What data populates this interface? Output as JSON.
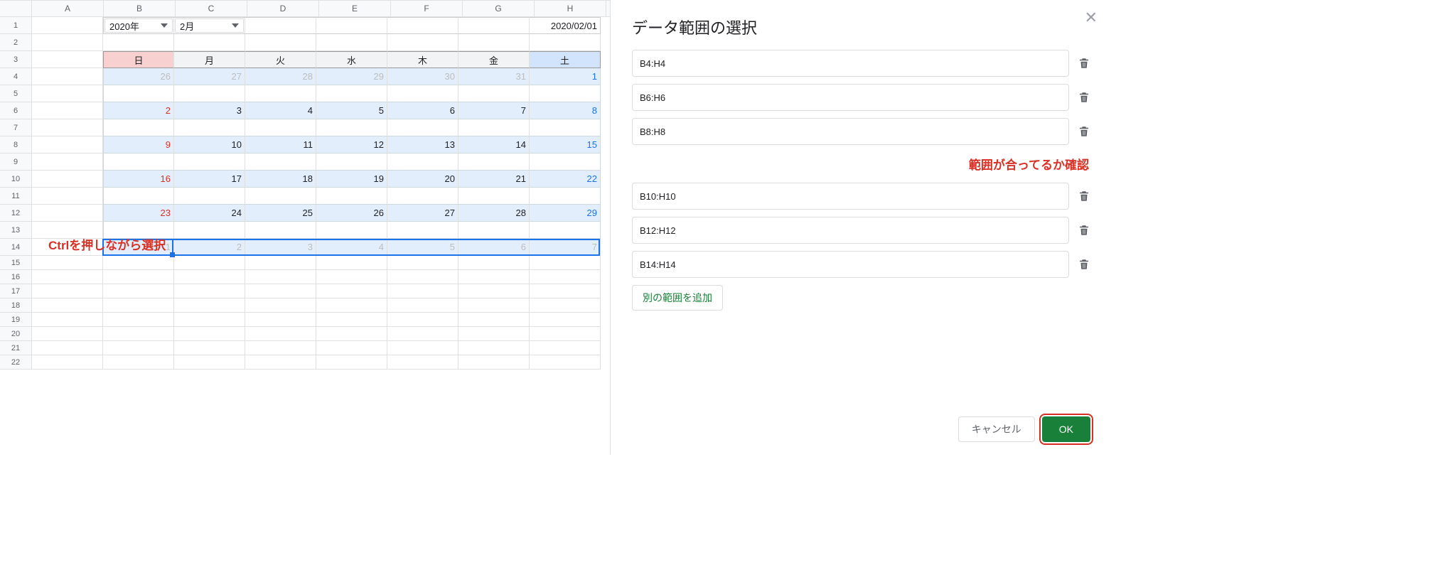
{
  "columns": [
    "A",
    "B",
    "C",
    "D",
    "E",
    "F",
    "G",
    "H"
  ],
  "row_count": 22,
  "dropdowns": {
    "year": "2020年",
    "month": "2月"
  },
  "date_cell": "2020/02/01",
  "day_headers": [
    "日",
    "月",
    "火",
    "水",
    "木",
    "金",
    "土"
  ],
  "calendar": [
    {
      "row": 4,
      "nums": [
        "26",
        "27",
        "28",
        "29",
        "30",
        "31",
        "1"
      ],
      "gray": [
        0,
        1,
        2,
        3,
        4,
        5
      ],
      "sun": null,
      "sat": 6
    },
    {
      "row": 6,
      "nums": [
        "2",
        "3",
        "4",
        "5",
        "6",
        "7",
        "8"
      ],
      "gray": [],
      "sun": 0,
      "sat": 6
    },
    {
      "row": 8,
      "nums": [
        "9",
        "10",
        "11",
        "12",
        "13",
        "14",
        "15"
      ],
      "gray": [],
      "sun": 0,
      "sat": 6
    },
    {
      "row": 10,
      "nums": [
        "16",
        "17",
        "18",
        "19",
        "20",
        "21",
        "22"
      ],
      "gray": [],
      "sun": 0,
      "sat": 6
    },
    {
      "row": 12,
      "nums": [
        "23",
        "24",
        "25",
        "26",
        "27",
        "28",
        "29"
      ],
      "gray": [],
      "sun": 0,
      "sat": 6
    },
    {
      "row": 14,
      "nums": [
        "1",
        "2",
        "3",
        "4",
        "5",
        "6",
        "7"
      ],
      "gray": [
        0,
        1,
        2,
        3,
        4,
        5,
        6
      ],
      "sun": null,
      "sat": null
    }
  ],
  "annotations": {
    "ctrl_hint": "Ctrlを押しながら選択",
    "confirm_hint": "範囲が合ってるか確認"
  },
  "panel": {
    "title": "データ範囲の選択",
    "ranges": [
      "B4:H4",
      "B6:H6",
      "B8:H8",
      "B10:H10",
      "B12:H12",
      "B14:H14"
    ],
    "add_label": "別の範囲を追加",
    "cancel_label": "キャンセル",
    "ok_label": "OK"
  }
}
